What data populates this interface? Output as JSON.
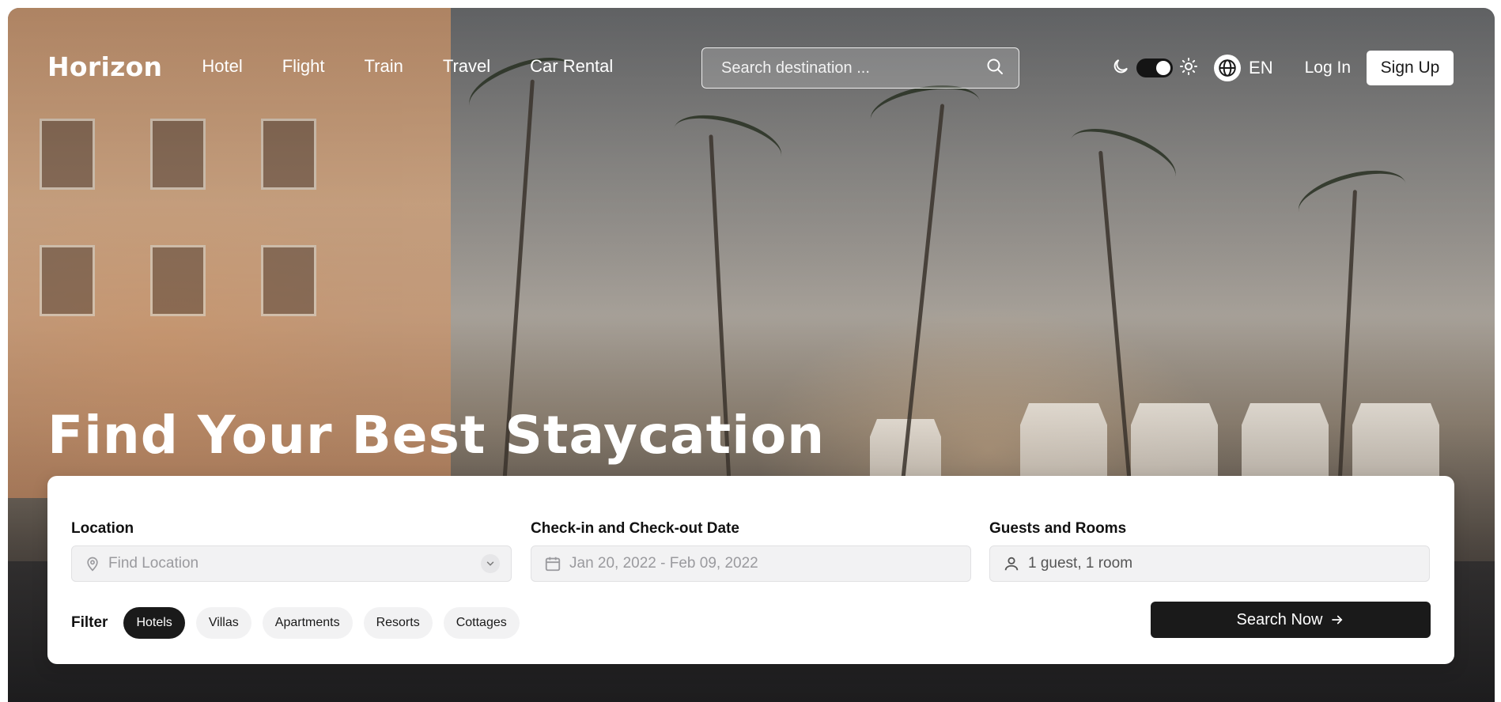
{
  "brand": {
    "logo": "Horizon"
  },
  "nav": {
    "links": [
      "Hotel",
      "Flight",
      "Train",
      "Travel",
      "Car Rental"
    ],
    "search_placeholder": "Search destination ...",
    "language": "EN",
    "login_label": "Log In",
    "signup_label": "Sign Up"
  },
  "icons": {
    "search": "search-icon",
    "moon": "moon-icon",
    "sun": "sun-icon",
    "globe": "globe-icon",
    "location": "location-pin-icon",
    "calendar": "calendar-icon",
    "user": "user-icon",
    "chevron": "chevron-down-icon",
    "arrow": "arrow-right-icon"
  },
  "hero": {
    "title": "Find Your Best Staycation"
  },
  "booking": {
    "location": {
      "label": "Location",
      "placeholder": "Find Location"
    },
    "dates": {
      "label": "Check-in and Check-out Date",
      "value": "Jan 20, 2022 - Feb 09, 2022"
    },
    "guests": {
      "label": "Guests and Rooms",
      "value": "1 guest, 1 room"
    },
    "filter_label": "Filter",
    "filters": [
      {
        "label": "Hotels",
        "active": true
      },
      {
        "label": "Villas",
        "active": false
      },
      {
        "label": "Apartments",
        "active": false
      },
      {
        "label": "Resorts",
        "active": false
      },
      {
        "label": "Cottages",
        "active": false
      }
    ],
    "search_button": "Search Now"
  },
  "colors": {
    "primary": "#1a1a1a",
    "card": "#ffffff",
    "field_bg": "#f2f2f3"
  }
}
